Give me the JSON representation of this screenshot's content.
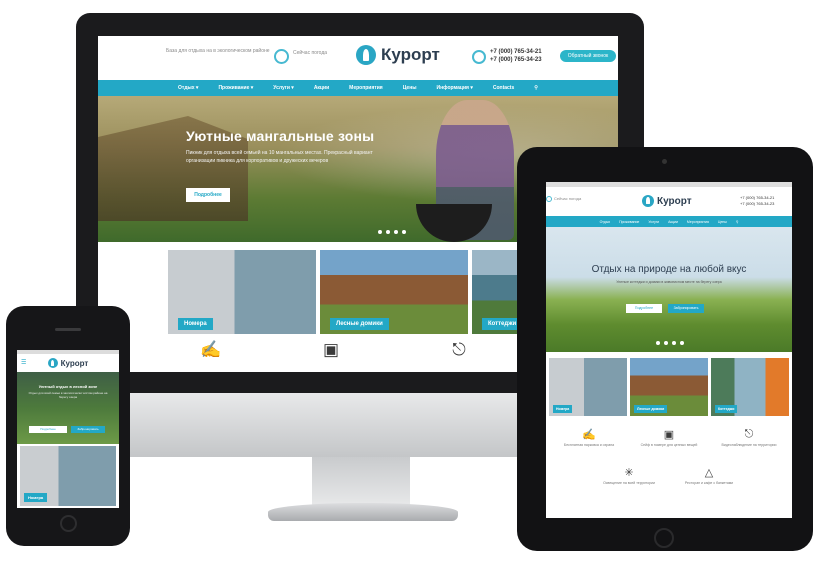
{
  "site": {
    "logo_text": "Курорт",
    "tagline": "База для отдыха на в экологическом районе",
    "weather": "Сейчас погода",
    "phone_1": "+7 (000) 765-34-21",
    "phone_2": "+7 (000) 765-34-23",
    "callback_label": "Обратный звонок",
    "accent_color": "#23a8c6"
  },
  "desktop": {
    "nav": [
      "Отдых ▾",
      "Проживание ▾",
      "Услуги ▾",
      "Акции",
      "Мероприятия",
      "Цены",
      "Информация ▾",
      "Contacts"
    ],
    "nav_search_icon": "search-icon",
    "hero": {
      "title": "Уютные мангальные зоны",
      "text": "Пикник для отдыха всей семьей на 10 мангальных местах. Прекрасный вариант организации пикника для корпоративов и дружеских вечеров",
      "button": "Подробнее"
    },
    "tiles": [
      "Номера",
      "Лесные домики",
      "Коттеджи"
    ],
    "feature_icons": [
      "hand-card-icon",
      "safe-icon",
      "camera-icon",
      "lamp-icon"
    ]
  },
  "tablet": {
    "nav": [
      "Отдых",
      "Проживание",
      "Услуги",
      "Акции",
      "Мероприятия",
      "Цены"
    ],
    "hero": {
      "title": "Отдых на природе на любой вкус",
      "text": "Уютные коттеджи и домики в живописном месте на берегу озера",
      "button_1": "Подробнее",
      "button_2": "Забронировать"
    },
    "tiles": [
      "Номера",
      "Лесные домики",
      "Коттеджи"
    ],
    "features": [
      {
        "icon": "hand-card-icon",
        "label": "Бесплатная парковка и охрана"
      },
      {
        "icon": "safe-icon",
        "label": "Сейф в номере для ценных вещей"
      },
      {
        "icon": "camera-icon",
        "label": "Видеонаблюдение на территории"
      },
      {
        "icon": "lamp-icon",
        "label": "Освещение на всей территории"
      },
      {
        "icon": "cake-icon",
        "label": "Ресторан и кафе с банкетами"
      }
    ]
  },
  "phone": {
    "menu_icon": "menu-icon",
    "hero": {
      "title": "Уютный отдых в лесной зоне",
      "text": "Отдых для всей семьи в экологически чистом районе на берегу озера",
      "button_1": "Подробнее",
      "button_2": "Забронировать"
    },
    "tile": "Номера"
  }
}
